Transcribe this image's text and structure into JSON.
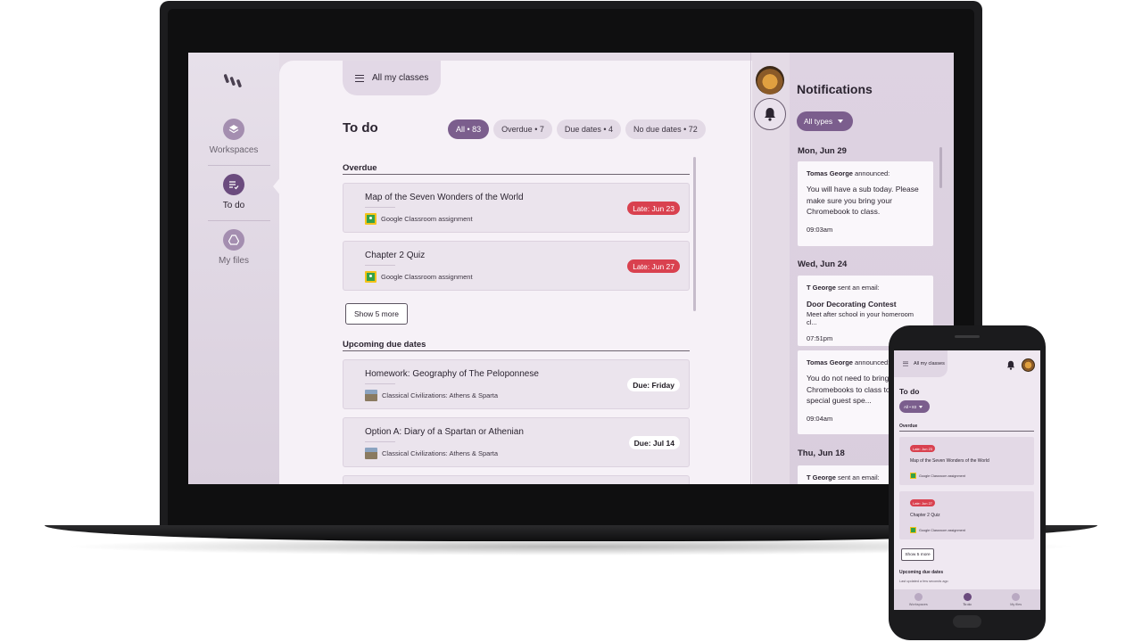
{
  "rail": {
    "items": [
      {
        "label": "Workspaces",
        "icon": "layers-icon"
      },
      {
        "label": "To do",
        "icon": "checklist-icon"
      },
      {
        "label": "My files",
        "icon": "drive-icon"
      }
    ]
  },
  "header": {
    "classes_label": "All my classes",
    "title": "To do"
  },
  "filters": [
    {
      "label": "All • 83"
    },
    {
      "label": "Overdue • 7"
    },
    {
      "label": "Due dates • 4"
    },
    {
      "label": "No due dates • 72"
    }
  ],
  "overdue": {
    "heading": "Overdue",
    "items": [
      {
        "title": "Map of the Seven Wonders of the World",
        "source": "Google Classroom assignment",
        "badge": "Late: Jun 23"
      },
      {
        "title": "Chapter 2 Quiz",
        "source": "Google Classroom assignment",
        "badge": "Late: Jun 27"
      }
    ],
    "show_more": "Show 5 more"
  },
  "upcoming": {
    "heading": "Upcoming due dates",
    "items": [
      {
        "title": "Homework: Geography of The Peloponnese",
        "source": "Classical Civilizations: Athens & Sparta",
        "badge": "Due: Friday"
      },
      {
        "title": "Option A: Diary of a Spartan or Athenian",
        "source": "Classical Civilizations: Athens & Sparta",
        "badge": "Due: Jul 14"
      }
    ]
  },
  "notifications": {
    "title": "Notifications",
    "filter_label": "All types",
    "groups": [
      {
        "date": "Mon, Jun 29",
        "cards": [
          {
            "who": "Tomas George",
            "action": " announced:",
            "subject": "",
            "body": "You will have a sub today. Please make sure you bring your Chromebook to class.",
            "time": "09:03am"
          }
        ]
      },
      {
        "date": "Wed, Jun 24",
        "cards": [
          {
            "who": "T George",
            "action": " sent an email:",
            "subject": "Door Decorating Contest",
            "body": "Meet after school in your homeroom cl...",
            "time": "07:51pm"
          },
          {
            "who": "Tomas George",
            "action": " announced:",
            "subject": "",
            "body": "You do not need to bring Chromebooks to class to have a special guest spe...",
            "time": "09:04am"
          }
        ]
      },
      {
        "date": "Thu, Jun 18",
        "cards": [
          {
            "who": "T George",
            "action": " sent an email:",
            "subject": "",
            "body": "",
            "time": ""
          }
        ]
      }
    ]
  },
  "phone": {
    "classes_label": "All my classes",
    "title": "To do",
    "chip": "All • 83",
    "overdue_heading": "Overdue",
    "cards": [
      {
        "badge": "Late: Jun 23",
        "title": "Map of the Seven Wonders of the World",
        "source": "Google Classroom assignment"
      },
      {
        "badge": "Late: Jun 27",
        "title": "Chapter 2 Quiz",
        "source": "Google Classroom assignment"
      }
    ],
    "show_more": "Show 5 more",
    "upcoming_heading": "Upcoming due dates",
    "updated": "Last updated a few seconds ago",
    "nav": [
      "Workspaces",
      "To do",
      "My files"
    ]
  },
  "colors": {
    "accent": "#7b5e8d",
    "late": "#d9414f",
    "surface": "#f6f1f7"
  }
}
